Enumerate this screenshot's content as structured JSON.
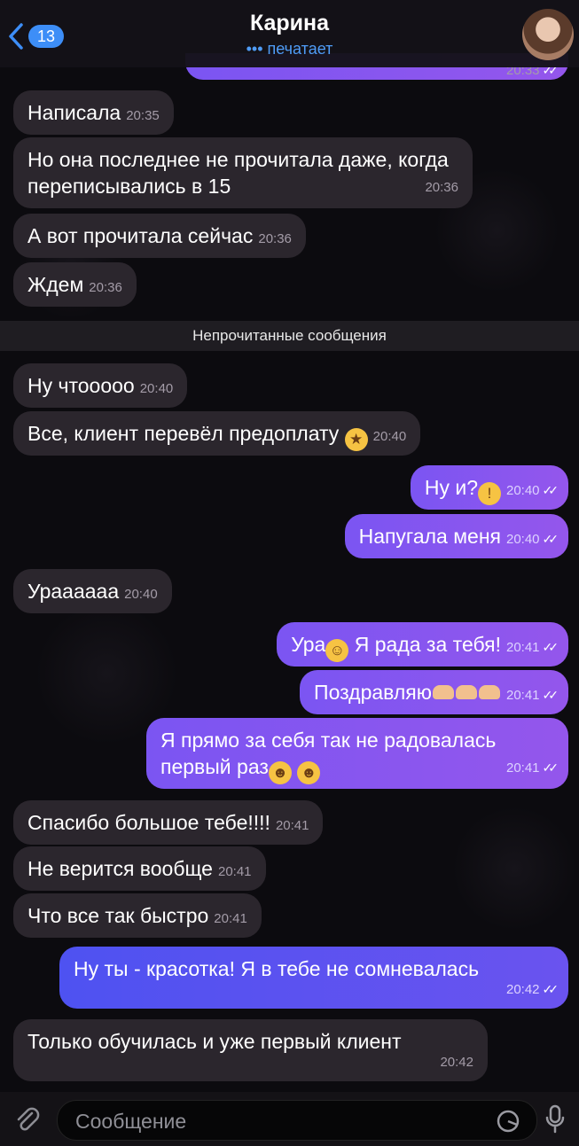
{
  "header": {
    "back_count": "13",
    "title": "Карина",
    "status": "••• печатает"
  },
  "unread_label": "Непрочитанные сообщения",
  "messages": [
    {
      "dir": "out",
      "text": "",
      "time": "20:33"
    },
    {
      "dir": "in",
      "text": "Написала",
      "time": "20:35"
    },
    {
      "dir": "in",
      "text": "Но она последнее не прочитала даже, когда переписывались в 15",
      "time": "20:36"
    },
    {
      "dir": "in",
      "text": "А вот прочитала сейчас",
      "time": "20:36"
    },
    {
      "dir": "in",
      "text": "Ждем",
      "time": "20:36"
    },
    {
      "dir": "in",
      "text": "Ну чтооооо",
      "time": "20:40"
    },
    {
      "dir": "in",
      "text": "Все, клиент перевёл предоплату",
      "time": "20:40"
    },
    {
      "dir": "out",
      "text": "Ну и?",
      "time": "20:40"
    },
    {
      "dir": "out",
      "text": "Напугала меня",
      "time": "20:40"
    },
    {
      "dir": "in",
      "text": "Урааааaa",
      "time": "20:40"
    },
    {
      "dir": "out",
      "text_a": "Ура",
      "text_b": "Я рада за тебя!",
      "time": "20:41"
    },
    {
      "dir": "out",
      "text": "Поздравляю",
      "time": "20:41"
    },
    {
      "dir": "out",
      "text": "Я прямо за себя так не радовалась первый раз",
      "time": "20:41"
    },
    {
      "dir": "in",
      "text": "Спасибо большое тебе!!!!",
      "time": "20:41"
    },
    {
      "dir": "in",
      "text": "Не верится вообще",
      "time": "20:41"
    },
    {
      "dir": "in",
      "text": "Что все так быстро",
      "time": "20:41"
    },
    {
      "dir": "out",
      "text": "Ну ты - красотка! Я в тебе не сомневалась",
      "time": "20:42"
    },
    {
      "dir": "in",
      "text": "Только обучилась и уже первый клиент",
      "time": "20:42"
    }
  ],
  "composer": {
    "placeholder": "Сообщение"
  },
  "icons": {
    "back": "chevron-left-icon",
    "attach": "paperclip-icon",
    "sticker": "sticker-icon",
    "mic": "microphone-icon"
  },
  "colors": {
    "accent": "#3d8ef7",
    "outgoing": "#8656ef",
    "incoming": "#2b262d"
  }
}
